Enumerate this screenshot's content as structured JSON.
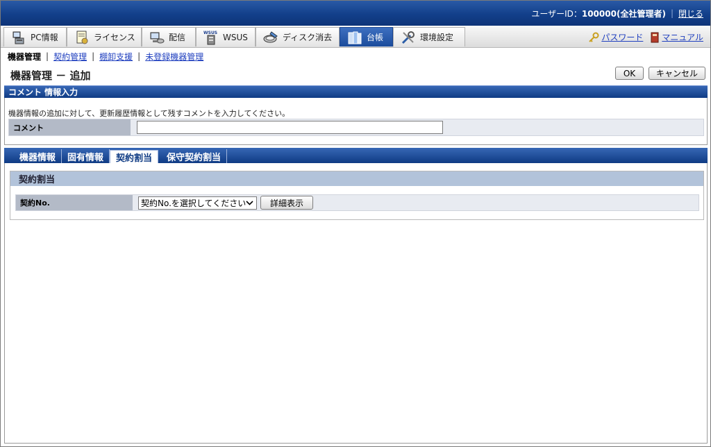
{
  "topbar": {
    "user_id_label": "ユーザーID：",
    "user_id_value": "100000(全社管理者)",
    "close_link": "閉じる"
  },
  "main_tabs": [
    {
      "label": "PC情報",
      "icon": "pc-icon"
    },
    {
      "label": "ライセンス",
      "icon": "license-icon"
    },
    {
      "label": "配信",
      "icon": "distribution-icon"
    },
    {
      "label": "WSUS",
      "icon": "wsus-icon",
      "icon_text": "WSUS"
    },
    {
      "label": "ディスク消去",
      "icon": "disk-erase-icon"
    },
    {
      "label": "台帳",
      "icon": "ledger-icon",
      "active": true
    },
    {
      "label": "環境設定",
      "icon": "settings-tools-icon"
    }
  ],
  "right_links": {
    "password": "パスワード",
    "manual": "マニュアル"
  },
  "subnav": {
    "current": "機器管理",
    "links": [
      "契約管理",
      "棚卸支援",
      "未登録機器管理"
    ]
  },
  "page": {
    "title": "機器管理 － 追加",
    "ok_button": "OK",
    "cancel_button": "キャンセル"
  },
  "comment_section": {
    "header": "コメント 情報入力",
    "description": "機器情報の追加に対して、更新履歴情報として残すコメントを入力してください。",
    "field_label": "コメント",
    "field_value": ""
  },
  "sub_tabs": [
    {
      "label": "機器情報"
    },
    {
      "label": "固有情報"
    },
    {
      "label": "契約割当",
      "active": true
    },
    {
      "label": "保守契約割当"
    }
  ],
  "contract_box": {
    "header": "契約割当",
    "field_label": "契約No.",
    "select_value": "契約No.を選択してください",
    "detail_button": "詳細表示"
  },
  "colors": {
    "header_blue": "#123f8a",
    "link_blue": "#1f3fbf",
    "label_gray": "#b3bac7",
    "box_head": "#b2c3da"
  }
}
